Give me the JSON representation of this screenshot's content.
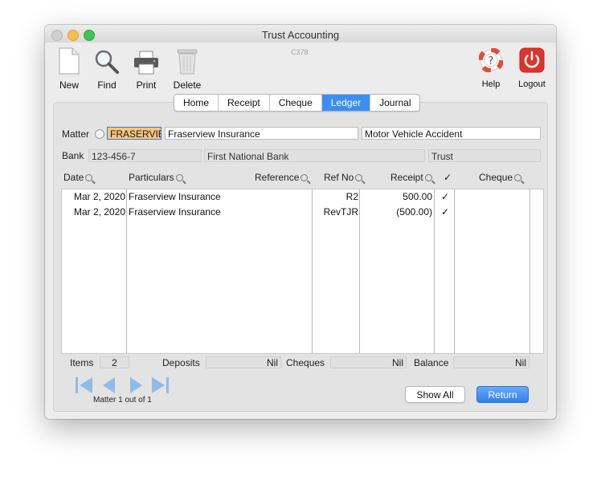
{
  "window": {
    "title": "Trust Accounting",
    "code": "C378"
  },
  "toolbar": {
    "new_label": "New",
    "find_label": "Find",
    "print_label": "Print",
    "delete_label": "Delete",
    "help_label": "Help",
    "logout_label": "Logout"
  },
  "tabs": [
    {
      "label": "Home",
      "active": false
    },
    {
      "label": "Receipt",
      "active": false
    },
    {
      "label": "Cheque",
      "active": false
    },
    {
      "label": "Ledger",
      "active": true
    },
    {
      "label": "Journal",
      "active": false
    }
  ],
  "matter": {
    "label": "Matter",
    "code": "FRASERVIE",
    "name": "Fraserview Insurance",
    "description": "Motor Vehicle Accident"
  },
  "bank": {
    "label": "Bank",
    "account": "123-456-7",
    "name": "First National Bank",
    "type": "Trust"
  },
  "columns": {
    "date": "Date",
    "particulars": "Particulars",
    "reference": "Reference",
    "ref_no": "Ref No",
    "receipt": "Receipt",
    "check": "✓",
    "cheque": "Cheque"
  },
  "rows": [
    {
      "date": "Mar 2, 2020",
      "particulars": "Fraserview Insurance",
      "reference": "",
      "ref_no": "R2",
      "receipt": "500.00",
      "check": "✓",
      "cheque": ""
    },
    {
      "date": "Mar 2, 2020",
      "particulars": "Fraserview Insurance",
      "reference": "",
      "ref_no": "RevTJR",
      "receipt": "(500.00)",
      "check": "✓",
      "cheque": ""
    }
  ],
  "footer": {
    "items_label": "Items",
    "items_value": "2",
    "deposits_label": "Deposits",
    "deposits_value": "Nil",
    "cheques_label": "Cheques",
    "cheques_value": "Nil",
    "balance_label": "Balance",
    "balance_value": "Nil"
  },
  "nav": {
    "matter_count": "Matter 1 out of 1"
  },
  "buttons": {
    "show_all": "Show All",
    "return": "Return"
  },
  "colors": {
    "accent": "#3b8ef3",
    "highlight": "#f8c680",
    "logout_red": "#e0332b"
  }
}
